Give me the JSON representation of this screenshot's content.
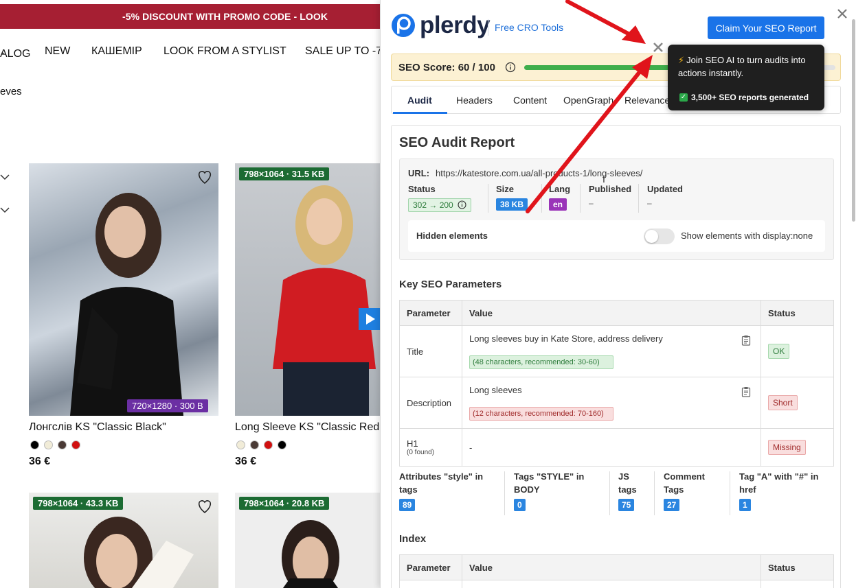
{
  "store": {
    "promo": "-5% DISCOUNT WITH PROMO CODE - LOOK",
    "nav": [
      "ALOG",
      "NEW",
      "КАШЕМІР",
      "LOOK FROM A STYLIST",
      "SALE UP TO -7"
    ],
    "breadcrumb": "eves",
    "products": [
      {
        "title": "Лонгслів KS \"Classic Black\"",
        "price": "36 €",
        "badge": "720×1280 · 300 B",
        "colors": [
          "#000000",
          "#f1ecd8",
          "#4a3a35",
          "#d01010"
        ]
      },
      {
        "title": "Long Sleeve KS \"Classic Red",
        "price": "36 €",
        "badge": "798×1064 · 31.5 KB",
        "colors": [
          "#f1ecd8",
          "#4a3a35",
          "#d01010",
          "#000000"
        ]
      },
      {
        "badge": "798×1064 · 43.3 KB"
      },
      {
        "badge": "798×1064 · 20.8 KB"
      }
    ]
  },
  "plerdy": {
    "logo_text": "plerdy",
    "free_tools": "Free CRO Tools",
    "claim_button": "Claim Your SEO Report",
    "score_label": "SEO Score: 60 / 100",
    "score_fraction": 0.6,
    "tabs": [
      "Audit",
      "Headers",
      "Content",
      "OpenGraph",
      "Relevance"
    ],
    "tooltip": {
      "line1": "Join SEO AI to turn audits into actions instantly.",
      "line2": "3,500+ SEO reports generated"
    },
    "audit": {
      "title": "SEO Audit Report",
      "url_label": "URL:",
      "url": "https://katestore.com.ua/all-products-1/long-sleeves/",
      "status_label": "Status",
      "status_value": "302 → 200",
      "size_label": "Size",
      "size_value": "38 KB",
      "lang_label": "Lang",
      "lang_value": "en",
      "published_label": "Published",
      "published_value": "–",
      "updated_label": "Updated",
      "updated_value": "–",
      "hidden_label": "Hidden elements",
      "hidden_toggle": "Show elements with display:none"
    },
    "key_params": {
      "heading": "Key SEO Parameters",
      "columns": [
        "Parameter",
        "Value",
        "Status"
      ],
      "rows": [
        {
          "param": "Title",
          "value": "Long sleeves buy in Kate Store, address delivery",
          "note": "(48 characters, recommended: 30-60)",
          "status": "OK"
        },
        {
          "param": "Description",
          "value": "Long sleeves",
          "note": "(12 characters, recommended: 70-160)",
          "status": "Short"
        },
        {
          "param": "H1",
          "sub": "(0 found)",
          "value": "-",
          "status": "Missing"
        }
      ]
    },
    "counters": [
      {
        "label": "Attributes \"style\" in tags",
        "value": "89"
      },
      {
        "label": "Tags \"STYLE\" in BODY",
        "value": "0"
      },
      {
        "label": "JS tags",
        "value": "75"
      },
      {
        "label": "Comment Tags",
        "value": "27"
      },
      {
        "label": "Tag \"A\" with \"#\" in href",
        "value": "1"
      }
    ],
    "index": {
      "heading": "Index",
      "columns": [
        "Parameter",
        "Value",
        "Status"
      ]
    }
  }
}
